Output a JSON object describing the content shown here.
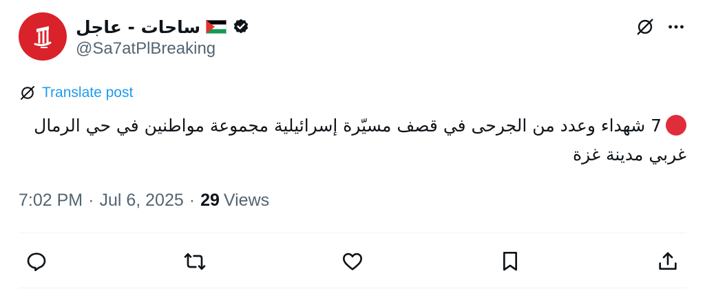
{
  "tweet": {
    "display_name": "ساحات - عاجل",
    "handle": "@Sa7atPlBreaking",
    "translate_label": "Translate post",
    "text": "7 شهداء وعدد من الجرحى في قصف مسيّرة إسرائيلية مجموعة مواطنين في حي الرمال غربي مدينة غزة",
    "time": "7:02 PM",
    "date": "Jul 6, 2025",
    "views_count": "29",
    "views_label": "Views"
  },
  "colors": {
    "avatar_bg": "#d9222a",
    "link": "#1d9bf0",
    "secondary_text": "#536471",
    "red_dot": "#e12c3b"
  },
  "icons": {
    "header": [
      "grok-icon",
      "more-icon"
    ],
    "translate": "grok-icon",
    "actions": [
      "reply-icon",
      "repost-icon",
      "like-icon",
      "bookmark-icon",
      "share-icon"
    ]
  }
}
